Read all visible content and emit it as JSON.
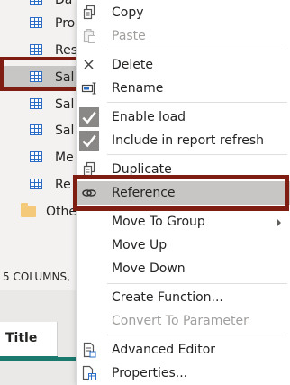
{
  "queries": [
    {
      "label": "Da",
      "kind": "table"
    },
    {
      "label": "Pro",
      "kind": "table"
    },
    {
      "label": "Res",
      "kind": "table"
    },
    {
      "label": "Sal",
      "kind": "table",
      "selected": true
    },
    {
      "label": "Sal",
      "kind": "table"
    },
    {
      "label": "Sal",
      "kind": "table"
    },
    {
      "label": "Me",
      "kind": "table"
    },
    {
      "label": "Re",
      "kind": "table"
    },
    {
      "label": "Othe",
      "kind": "folder"
    }
  ],
  "status_text": "5 COLUMNS,",
  "bottom_tab": {
    "label": "Title"
  },
  "menu": {
    "copy": "Copy",
    "paste": "Paste",
    "delete": "Delete",
    "rename": "Rename",
    "enable_load": "Enable load",
    "include_refresh": "Include in report refresh",
    "duplicate": "Duplicate",
    "reference": "Reference",
    "move_to_group": "Move To Group",
    "move_up": "Move Up",
    "move_down": "Move Down",
    "create_function": "Create Function...",
    "convert_parameter": "Convert To Parameter",
    "advanced_editor": "Advanced Editor",
    "properties": "Properties..."
  },
  "colors": {
    "highlight_frame": "#7f1d12",
    "selection": "#c8c6c4",
    "accent": "#1b7a6e"
  }
}
